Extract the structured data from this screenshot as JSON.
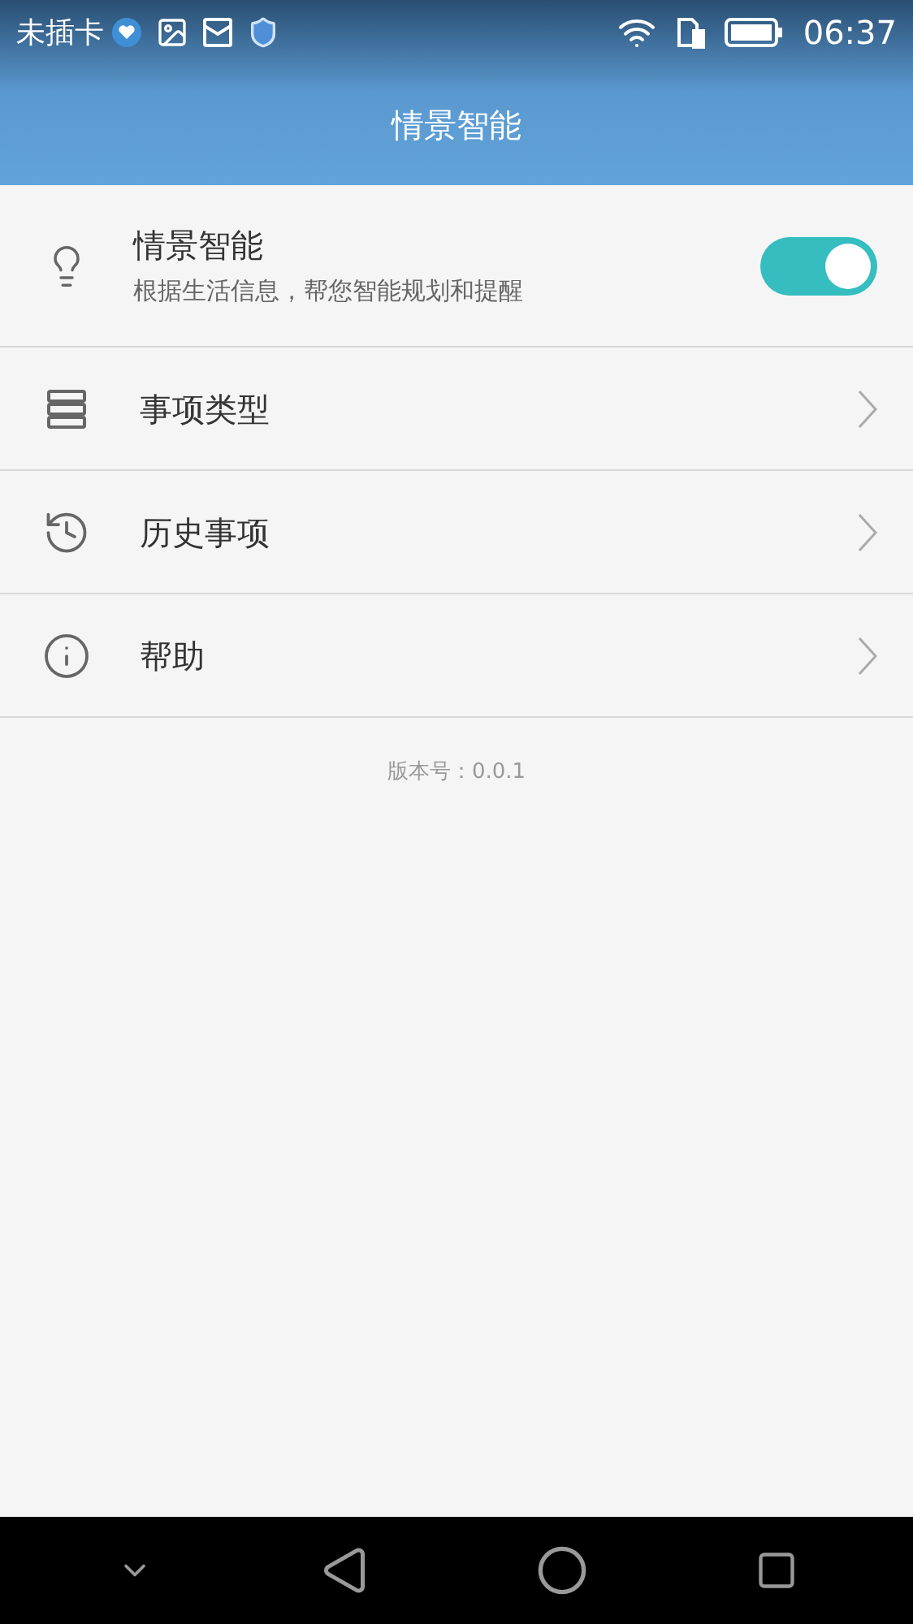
{
  "status_bar": {
    "carrier": "未插卡",
    "time": "06:37"
  },
  "header": {
    "title": "情景智能"
  },
  "items": [
    {
      "kind": "toggle",
      "title": "情景智能",
      "subtitle": "根据生活信息，帮您智能规划和提醒",
      "on": true
    },
    {
      "kind": "link",
      "title": "事项类型"
    },
    {
      "kind": "link",
      "title": "历史事项"
    },
    {
      "kind": "link",
      "title": "帮助"
    }
  ],
  "version": "版本号：0.0.1"
}
